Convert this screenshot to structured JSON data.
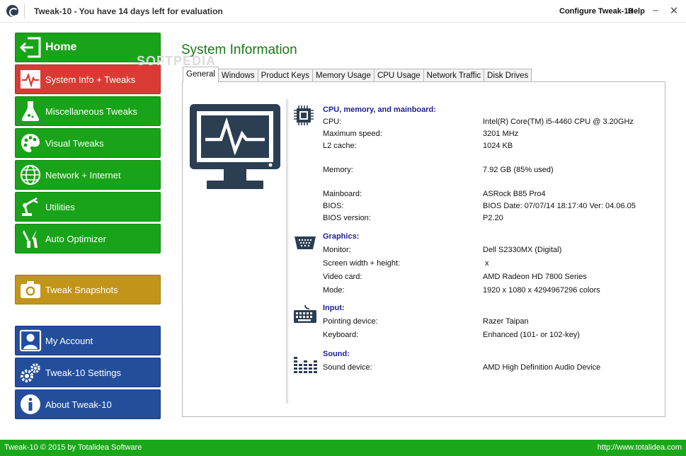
{
  "window": {
    "title": "Tweak-10 - You have 14 days left for evaluation",
    "menu": {
      "configure": "Configure Tweak-10",
      "help": "Help"
    },
    "controls": {
      "minimize": "−",
      "close": "✕"
    }
  },
  "sidebar": {
    "items": [
      {
        "label": "Home",
        "icon": "home-exit-icon",
        "color": "#18a318"
      },
      {
        "label": "System Info + Tweaks",
        "icon": "heartbeat-icon",
        "color": "#d93b34"
      },
      {
        "label": "Miscellaneous Tweaks",
        "icon": "flask-icon",
        "color": "#18a318"
      },
      {
        "label": "Visual Tweaks",
        "icon": "palette-icon",
        "color": "#18a318"
      },
      {
        "label": "Network + Internet",
        "icon": "globe-icon",
        "color": "#18a318"
      },
      {
        "label": "Utilities",
        "icon": "robot-arm-icon",
        "color": "#18a318"
      },
      {
        "label": "Auto Optimizer",
        "icon": "tools-icon",
        "color": "#18a318"
      },
      {
        "label": "Tweak Snapshots",
        "icon": "camera-icon",
        "color": "#c2951a"
      },
      {
        "label": "My Account",
        "icon": "user-icon",
        "color": "#234e9c"
      },
      {
        "label": "Tweak-10 Settings",
        "icon": "gears-icon",
        "color": "#234e9c"
      },
      {
        "label": "About Tweak-10",
        "icon": "info-icon",
        "color": "#234e9c"
      }
    ]
  },
  "main": {
    "title": "System Information",
    "watermark": "SOFTPEDIA",
    "tabs": [
      "General",
      "Windows",
      "Product Keys",
      "Memory Usage",
      "CPU Usage",
      "Network Traffic",
      "Disk Drives"
    ],
    "sections": {
      "cpu": {
        "header": "CPU, memory, and mainboard:",
        "rows": [
          {
            "label": "CPU:",
            "value": "Intel(R) Core(TM) i5-4460  CPU @ 3.20GHz"
          },
          {
            "label": "Maximum speed:",
            "value": "3201 MHz"
          },
          {
            "label": "L2 cache:",
            "value": "1024 KB"
          },
          {
            "label": "Memory:",
            "value": "7.92 GB (85% used)"
          },
          {
            "label": "Mainboard:",
            "value": "ASRock B85 Pro4"
          },
          {
            "label": "BIOS:",
            "value": "BIOS Date: 07/07/14 18:17:40 Ver: 04.06.05"
          },
          {
            "label": "BIOS version:",
            "value": "P2.20"
          }
        ]
      },
      "graphics": {
        "header": "Graphics:",
        "rows": [
          {
            "label": "Monitor:",
            "value": "Dell S2330MX (Digital)"
          },
          {
            "label": "Screen width + height:",
            "value": "x"
          },
          {
            "label": "Video card:",
            "value": "AMD Radeon HD 7800 Series"
          },
          {
            "label": "Mode:",
            "value": "1920 x 1080 x 4294967296 colors"
          }
        ]
      },
      "input": {
        "header": "Input:",
        "rows": [
          {
            "label": "Pointing device:",
            "value": "Razer Taipan"
          },
          {
            "label": "Keyboard:",
            "value": "Enhanced (101- or 102-key)"
          }
        ]
      },
      "sound": {
        "header": "Sound:",
        "rows": [
          {
            "label": "Sound device:",
            "value": "AMD High Definition Audio Device"
          }
        ]
      }
    }
  },
  "status": {
    "left": "Tweak-10 © 2015 by Totalidea Software",
    "right": "http://www.totalidea.com"
  }
}
